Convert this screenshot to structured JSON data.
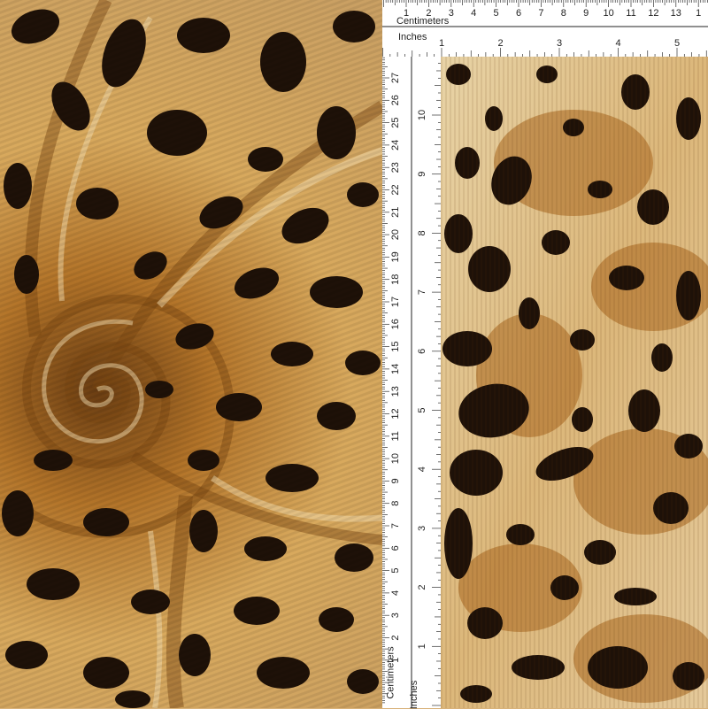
{
  "rulers": {
    "top": {
      "units_label_top": "Centimeters",
      "units_label_bottom": "Inches",
      "cm_ticks": [
        "1",
        "2",
        "3",
        "4",
        "5",
        "6",
        "7",
        "8",
        "9",
        "10",
        "11",
        "12",
        "13",
        "1"
      ],
      "inch_ticks": [
        "1",
        "2",
        "3",
        "4",
        "5"
      ]
    },
    "left": {
      "units_label_cm": "Centimeters",
      "units_label_in": "Inches",
      "cm_ticks": [
        "27",
        "26",
        "25",
        "24",
        "23",
        "22",
        "21",
        "20",
        "19",
        "18",
        "17",
        "16",
        "15",
        "14",
        "13",
        "12",
        "11",
        "10",
        "9",
        "8",
        "7",
        "6",
        "5",
        "4",
        "3",
        "2",
        "1"
      ],
      "inch_ticks": [
        "10",
        "9",
        "8",
        "7",
        "6",
        "5",
        "4",
        "3",
        "2",
        "1"
      ]
    }
  },
  "colors": {
    "fabric_light": "#e7d2a8",
    "fabric_mid": "#c58a3c",
    "fabric_tan": "#a8641c",
    "spot_dark": "#1e1108",
    "ruler_bg": "#ffffff"
  }
}
